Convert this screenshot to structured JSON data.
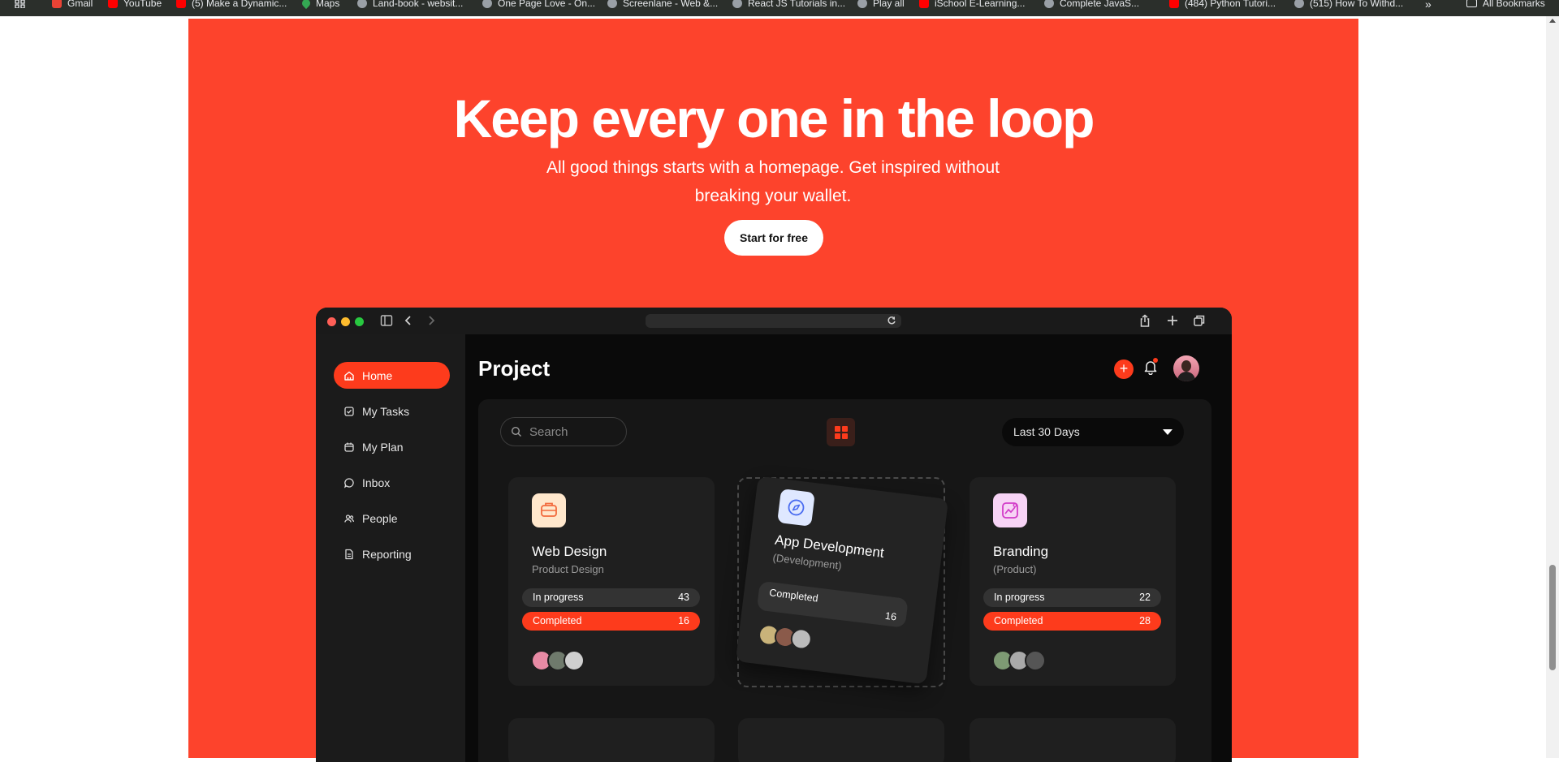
{
  "browser": {
    "bookmarks": [
      {
        "label": "Gmail",
        "icon": "gmail-icon"
      },
      {
        "label": "YouTube",
        "icon": "youtube-icon"
      },
      {
        "label": "(5) Make a Dynamic...",
        "icon": "youtube-icon"
      },
      {
        "label": "Maps",
        "icon": "maps-icon"
      },
      {
        "label": "Land-book - websit...",
        "icon": "globe-icon"
      },
      {
        "label": "One Page Love - On...",
        "icon": "globe-icon"
      },
      {
        "label": "Screenlane - Web &...",
        "icon": "globe-icon"
      },
      {
        "label": "React JS Tutorials in...",
        "icon": "globe-icon"
      },
      {
        "label": "Play all",
        "icon": "globe-icon"
      },
      {
        "label": "iSchool E-Learning...",
        "icon": "youtube-icon"
      },
      {
        "label": "Complete JavaS...",
        "icon": "globe-icon"
      },
      {
        "label": "(484) Python Tutori...",
        "icon": "youtube-icon"
      },
      {
        "label": "(515) How To Withd...",
        "icon": "globe-icon"
      }
    ],
    "more": "»",
    "all_bookmarks": "All Bookmarks"
  },
  "hero": {
    "title": "Keep every one in the loop",
    "subtitle": "All good things starts with a homepage. Get inspired without breaking your wallet.",
    "cta": "Start for free",
    "background": "#fd432c"
  },
  "app": {
    "nav": [
      {
        "label": "Home",
        "icon": "home-icon",
        "active": true
      },
      {
        "label": "My Tasks",
        "icon": "check-square-icon"
      },
      {
        "label": "My Plan",
        "icon": "calendar-icon"
      },
      {
        "label": "Inbox",
        "icon": "chat-icon"
      },
      {
        "label": "People",
        "icon": "people-icon"
      },
      {
        "label": "Reporting",
        "icon": "report-icon"
      }
    ],
    "title": "Project",
    "add": "+",
    "search_placeholder": "Search",
    "range": "Last 30 Days",
    "accent": "#fd3b1c",
    "cards": [
      {
        "title": "Web Design",
        "subtitle": "Product Design",
        "in_progress_label": "In progress",
        "in_progress": "43",
        "completed_label": "Completed",
        "completed": "16",
        "icon": "briefcase-icon"
      },
      {
        "title": "App Development",
        "subtitle": "(Development)",
        "completed_label": "Completed",
        "completed": "16",
        "icon": "compass-icon"
      },
      {
        "title": "Branding",
        "subtitle": "(Product)",
        "in_progress_label": "In progress",
        "in_progress": "22",
        "completed_label": "Completed",
        "completed": "28",
        "icon": "chart-icon"
      }
    ]
  }
}
